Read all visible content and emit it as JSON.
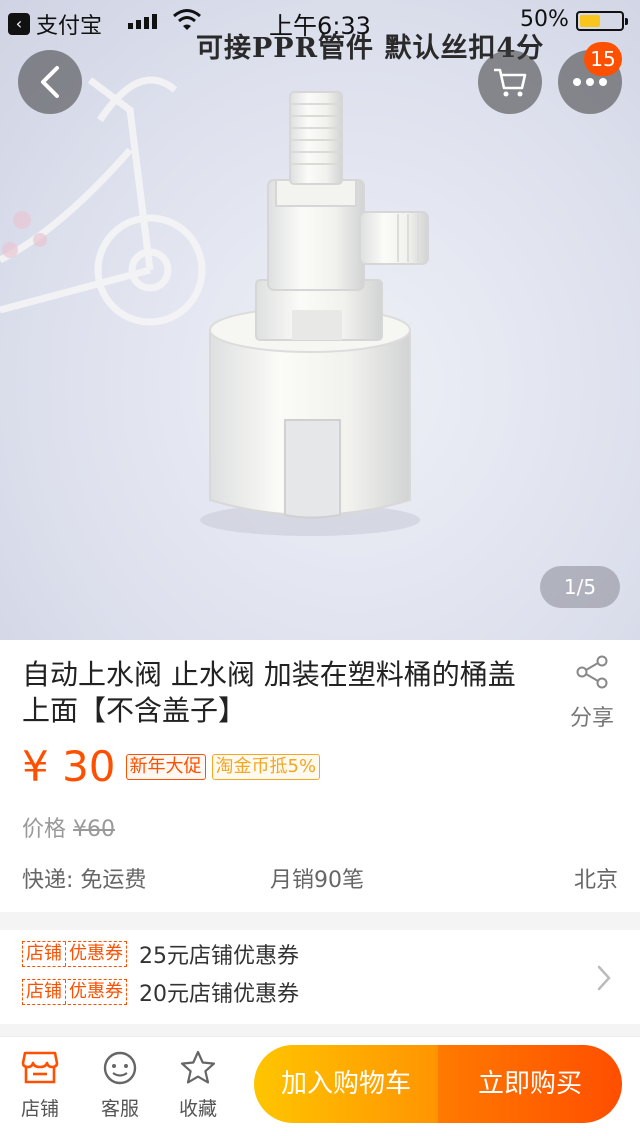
{
  "status_bar": {
    "back_app": "支付宝",
    "time": "上午6:33",
    "battery_pct": "50%",
    "battery_level": 0.5
  },
  "hero": {
    "banner_text": "可接PPR管件 默认丝扣4分",
    "indicator": "1/5"
  },
  "header": {
    "cart_badge": "15",
    "icons": [
      "back-icon",
      "cart-icon",
      "more-icon"
    ]
  },
  "product": {
    "title": "自动上水阀  止水阀 加装在塑料桶的桶盖上面【不含盖子】",
    "share_label": "分享",
    "price": "¥ 30",
    "tags": [
      "新年大促",
      "淘金币抵5%"
    ],
    "orig_label": "价格",
    "orig_price": "¥60",
    "shipping": "快递: 免运费",
    "monthly_sales": "月销90笔",
    "location": "北京"
  },
  "coupons": [
    {
      "tag_a": "店铺",
      "tag_b": "优惠券",
      "text": "25元店铺优惠券"
    },
    {
      "tag_a": "店铺",
      "tag_b": "优惠券",
      "text": "20元店铺优惠券"
    }
  ],
  "bottom_bar": {
    "shop": "店铺",
    "service": "客服",
    "favorite": "收藏",
    "add_to_cart": "加入购物车",
    "buy_now": "立即购买"
  },
  "colors": {
    "accent": "#ff5000",
    "cart_button": "#ffb300",
    "buy_button": "#ff5a00"
  }
}
